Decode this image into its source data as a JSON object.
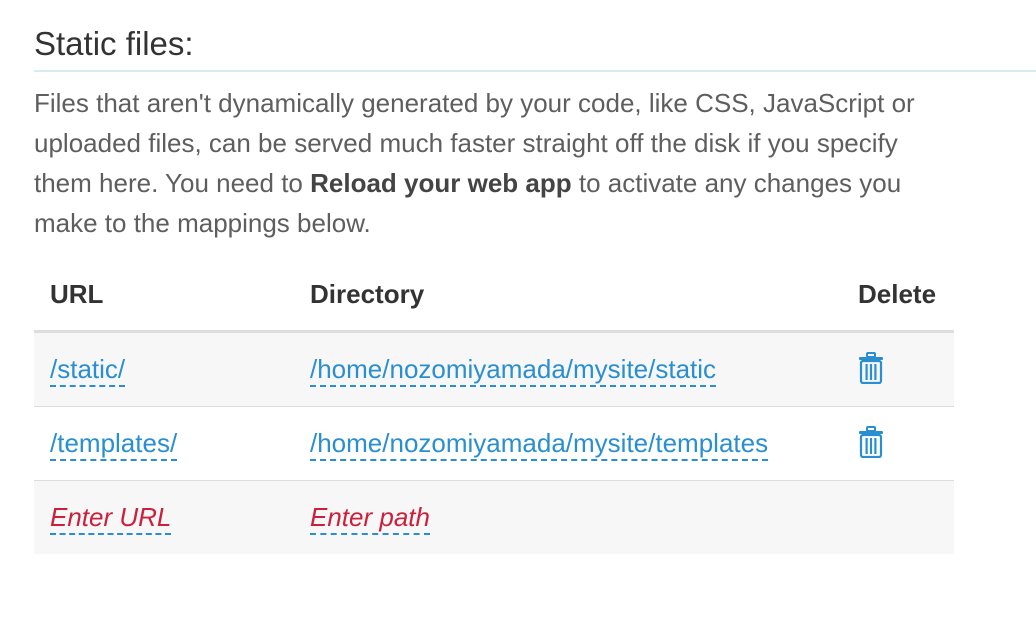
{
  "section": {
    "title": "Static files:",
    "description_part1": "Files that aren't dynamically generated by your code, like CSS, JavaScript or uploaded files, can be served much faster straight off the disk if you specify them here. You need to ",
    "description_bold": "Reload your web app",
    "description_part2": " to activate any changes you make to the mappings below."
  },
  "table": {
    "headers": {
      "url": "URL",
      "directory": "Directory",
      "delete": "Delete"
    },
    "rows": [
      {
        "url": "/static/",
        "directory": "/home/nozomiyamada/mysite/static"
      },
      {
        "url": "/templates/",
        "directory": "/home/nozomiyamada/mysite/templates"
      }
    ],
    "new_row": {
      "url_placeholder": "Enter URL",
      "path_placeholder": "Enter path"
    }
  },
  "colors": {
    "link": "#2a8fd0",
    "placeholder": "#cc1f3c",
    "divider": "#d6ecf2"
  },
  "icons": {
    "delete": "trash-icon"
  }
}
